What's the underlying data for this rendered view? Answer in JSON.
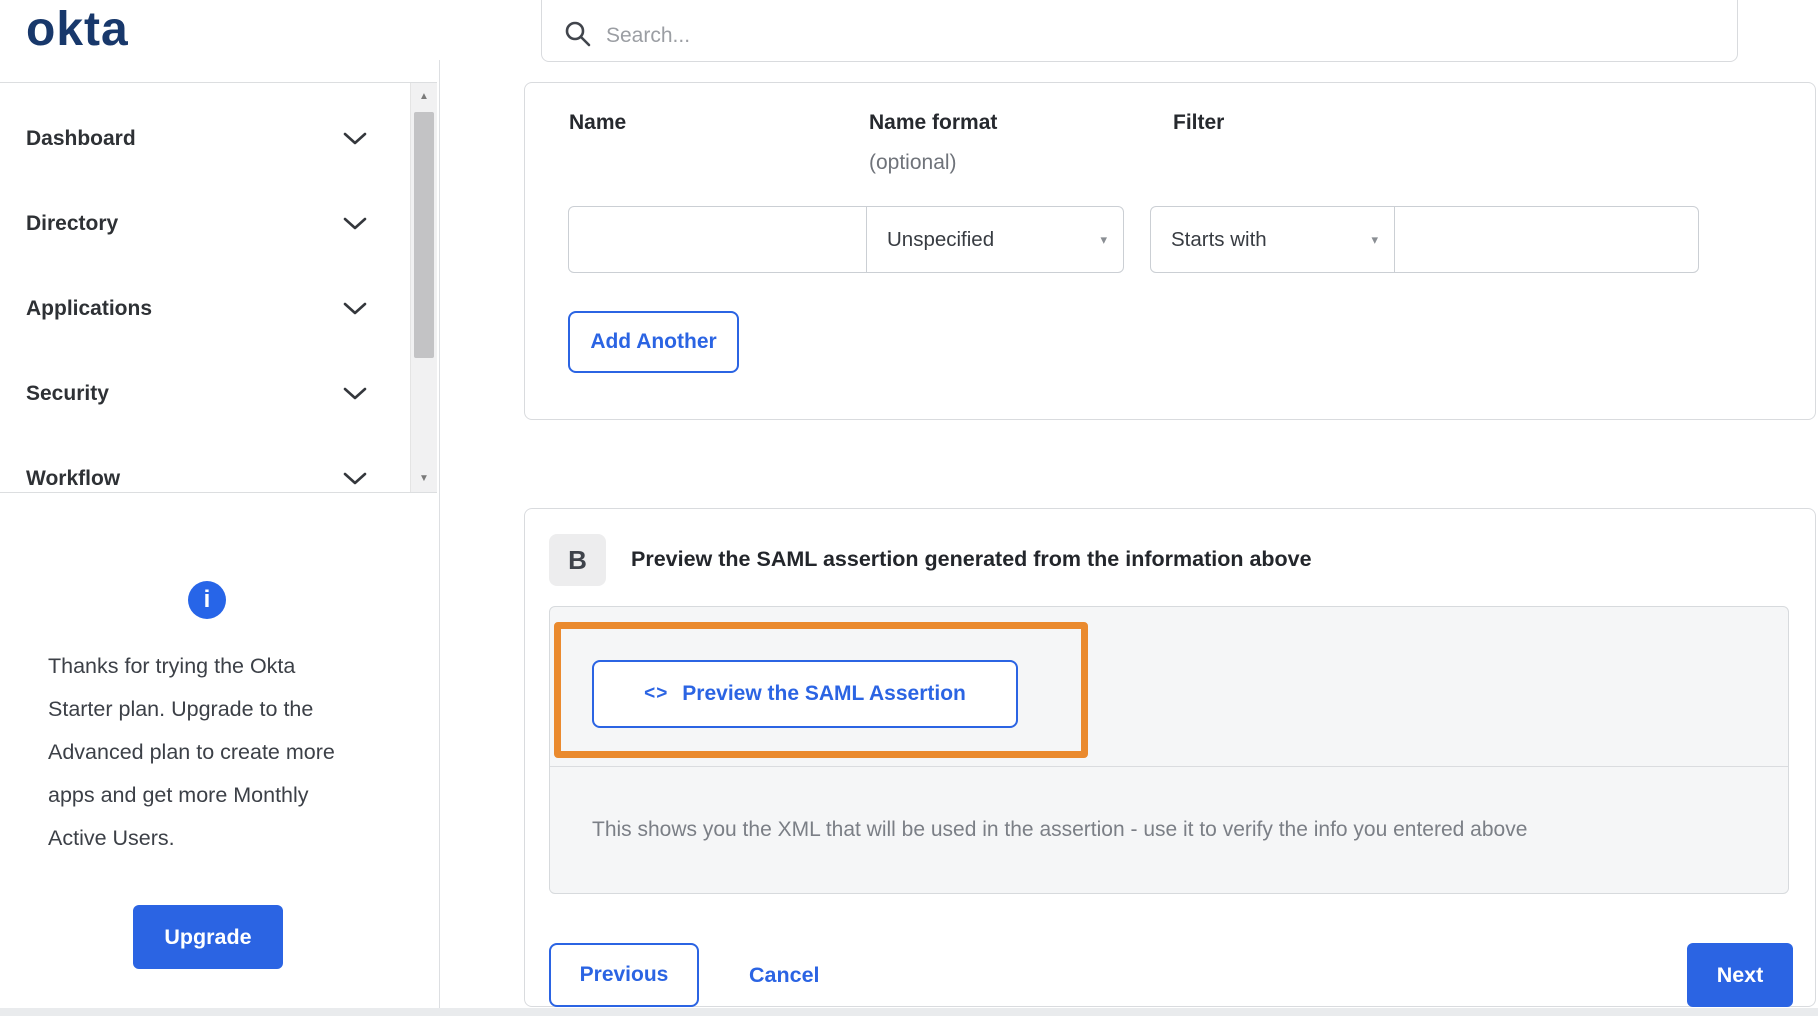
{
  "brand": {
    "logo_text": "okta",
    "logo_color": "#18386b"
  },
  "search": {
    "placeholder": "Search..."
  },
  "sidebar": {
    "items": [
      {
        "label": "Dashboard"
      },
      {
        "label": "Directory"
      },
      {
        "label": "Applications"
      },
      {
        "label": "Security"
      },
      {
        "label": "Workflow"
      }
    ],
    "plan_notice": "Thanks for trying the Okta Starter plan. Upgrade to the Advanced plan to create more apps and get more Monthly Active Users.",
    "upgrade_label": "Upgrade"
  },
  "attribute_form": {
    "columns": {
      "name": "Name",
      "name_format": "Name format",
      "name_format_note": "(optional)",
      "filter": "Filter"
    },
    "row": {
      "name_value": "",
      "name_format_value": "Unspecified",
      "filter_type_value": "Starts with",
      "filter_value": ""
    },
    "add_another_label": "Add Another"
  },
  "preview_section": {
    "badge": "B",
    "title": "Preview the SAML assertion generated from the information above",
    "button_icon": "<>",
    "button_label": "Preview the SAML Assertion",
    "note": "This shows you the XML that will be used in the assertion - use it to verify the info you entered above"
  },
  "footer": {
    "previous": "Previous",
    "cancel": "Cancel",
    "next": "Next"
  },
  "icons": {
    "scroll_up": "▲",
    "scroll_down": "▼",
    "dropdown_arrow": "▾",
    "info": "i"
  },
  "colors": {
    "accent_blue": "#2b64e3",
    "highlight_orange": "#ea8a2e",
    "logo_navy": "#18386b",
    "border_gray": "#d9dbde",
    "panel_gray": "#f5f6f7"
  }
}
